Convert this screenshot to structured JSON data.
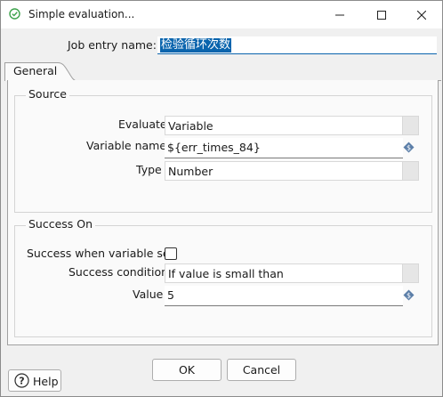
{
  "window": {
    "title": "Simple evaluation..."
  },
  "job_entry": {
    "label": "Job entry name:",
    "value": "检验循环次数"
  },
  "tabs": [
    {
      "label": "General"
    }
  ],
  "source": {
    "title": "Source",
    "evaluate": {
      "label": "Evaluate",
      "value": "Variable"
    },
    "variable_name": {
      "label": "Variable name",
      "value": "${err_times_84}"
    },
    "type": {
      "label": "Type",
      "value": "Number"
    }
  },
  "success_on": {
    "title": "Success On",
    "success_when_variable_set": {
      "label": "Success when variable set",
      "checked": false
    },
    "success_condition": {
      "label": "Success condition",
      "value": "If value is small than"
    },
    "value": {
      "label": "Value",
      "value": "5"
    }
  },
  "buttons": {
    "ok": "OK",
    "cancel": "Cancel",
    "help": "Help"
  },
  "colors": {
    "accent": "#0a64ad",
    "app_icon": "#3fa34d",
    "variable_icon": "#5b7ea8"
  },
  "icons": [
    "app-icon",
    "minimize-icon",
    "maximize-icon",
    "close-icon",
    "variable-icon",
    "help-icon"
  ]
}
